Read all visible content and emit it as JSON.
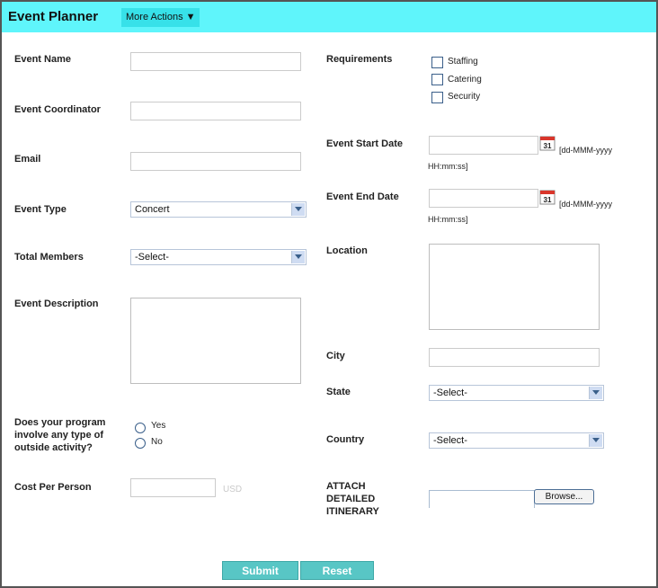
{
  "header": {
    "title": "Event Planner",
    "more_actions": "More Actions ▼"
  },
  "left": {
    "event_name": "Event Name",
    "event_coordinator": "Event Coordinator",
    "email": "Email",
    "event_type": {
      "label": "Event Type",
      "value": "Concert"
    },
    "total_members": {
      "label": "Total Members",
      "value": "-Select-"
    },
    "event_description": "Event Description",
    "outside_activity": {
      "line1": "Does your program",
      "line2": "involve any type of",
      "line3": "outside activity?",
      "yes": "Yes",
      "no": "No"
    },
    "cost_per_person": {
      "label": "Cost Per Person",
      "unit": "USD"
    }
  },
  "right": {
    "requirements": {
      "label": "Requirements",
      "options": [
        "Staffing",
        "Catering",
        "Security"
      ]
    },
    "start_date": {
      "label": "Event Start Date",
      "hint1": "[dd-MMM-yyyy",
      "hint2": "HH:mm:ss]",
      "cal": "31"
    },
    "end_date": {
      "label": "Event End Date",
      "hint1": "[dd-MMM-yyyy",
      "hint2": "HH:mm:ss]",
      "cal": "31"
    },
    "location": "Location",
    "city": "City",
    "state": {
      "label": "State",
      "value": "-Select-"
    },
    "country": {
      "label": "Country",
      "value": "-Select-"
    },
    "attach": {
      "line1": "ATTACH",
      "line2": "DETAILED",
      "line3": "ITINERARY",
      "browse": "Browse..."
    }
  },
  "actions": {
    "submit": "Submit",
    "reset": "Reset"
  },
  "colors": {
    "header_bg": "#5ff5fb",
    "button_bg": "#58c6c5"
  }
}
